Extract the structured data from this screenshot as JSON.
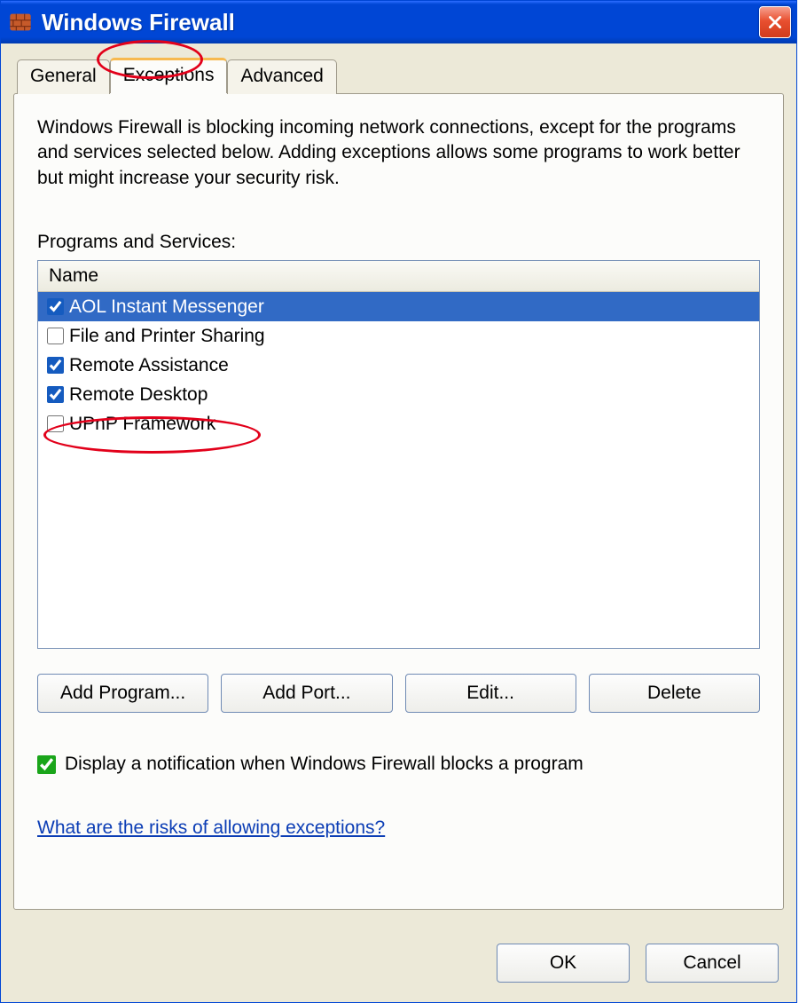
{
  "titlebar": {
    "title": "Windows Firewall"
  },
  "tabs": [
    {
      "label": "General",
      "active": false
    },
    {
      "label": "Exceptions",
      "active": true
    },
    {
      "label": "Advanced",
      "active": false
    }
  ],
  "panel": {
    "description": "Windows Firewall is blocking incoming network connections, except for the programs and services selected below. Adding exceptions allows some programs to work better but might increase your security risk.",
    "list_label": "Programs and Services:",
    "column_header": "Name",
    "items": [
      {
        "label": "AOL Instant Messenger",
        "checked": true,
        "selected": true
      },
      {
        "label": "File and Printer Sharing",
        "checked": false,
        "selected": false
      },
      {
        "label": "Remote Assistance",
        "checked": true,
        "selected": false
      },
      {
        "label": "Remote Desktop",
        "checked": true,
        "selected": false
      },
      {
        "label": "UPnP Framework",
        "checked": false,
        "selected": false
      }
    ],
    "buttons": {
      "add_program": "Add Program...",
      "add_port": "Add Port...",
      "edit": "Edit...",
      "delete": "Delete"
    },
    "notify": {
      "checked": true,
      "label": "Display a notification when Windows Firewall blocks a program"
    },
    "risks_link": "What are the risks of allowing exceptions?"
  },
  "dialog": {
    "ok": "OK",
    "cancel": "Cancel"
  }
}
